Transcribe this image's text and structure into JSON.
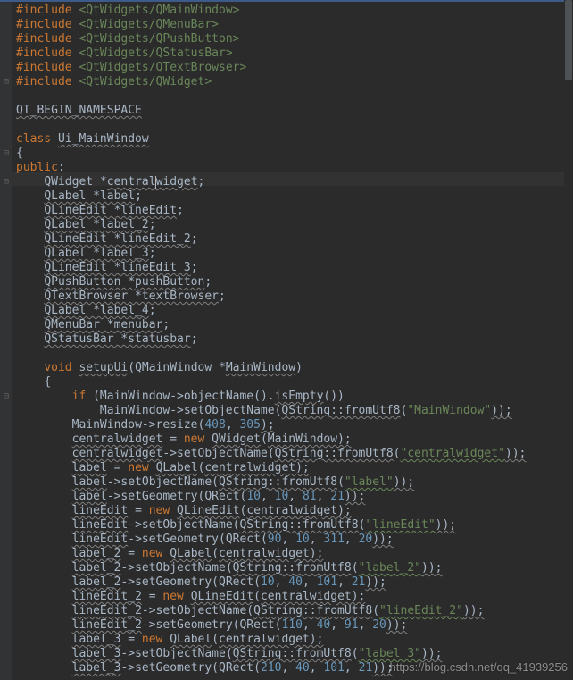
{
  "watermark": "https://blog.csdn.net/qq_41939256",
  "gutter_foldmarks": {
    "0": "",
    "1": "",
    "2": "",
    "3": "",
    "4": "",
    "5": "⊟",
    "9": "",
    "10": "⊟",
    "12": "⊟",
    "26": "",
    "27": "⊟"
  },
  "code_lines": [
    {
      "indent": 0,
      "segs": [
        {
          "cls": "tok-pre",
          "t": "#include "
        },
        {
          "cls": "tok-inc",
          "t": "<QtWidgets/QMainWindow>"
        }
      ]
    },
    {
      "indent": 0,
      "segs": [
        {
          "cls": "tok-pre",
          "t": "#include "
        },
        {
          "cls": "tok-inc",
          "t": "<QtWidgets/QMenuBar>"
        }
      ]
    },
    {
      "indent": 0,
      "segs": [
        {
          "cls": "tok-pre",
          "t": "#include "
        },
        {
          "cls": "tok-inc",
          "t": "<QtWidgets/QPushButton>"
        }
      ]
    },
    {
      "indent": 0,
      "segs": [
        {
          "cls": "tok-pre",
          "t": "#include "
        },
        {
          "cls": "tok-inc",
          "t": "<QtWidgets/QStatusBar>"
        }
      ]
    },
    {
      "indent": 0,
      "segs": [
        {
          "cls": "tok-pre",
          "t": "#include "
        },
        {
          "cls": "tok-inc",
          "t": "<QtWidgets/QTextBrowser>"
        }
      ]
    },
    {
      "indent": 0,
      "segs": [
        {
          "cls": "tok-pre",
          "t": "#include "
        },
        {
          "cls": "tok-inc",
          "t": "<QtWidgets/QWidget>"
        }
      ]
    },
    {
      "indent": 0,
      "segs": []
    },
    {
      "indent": 0,
      "segs": [
        {
          "cls": "tok-macro us",
          "t": "QT_BEGIN_NAMESPACE"
        }
      ]
    },
    {
      "indent": 0,
      "segs": []
    },
    {
      "indent": 0,
      "segs": [
        {
          "cls": "tok-kw",
          "t": "class "
        },
        {
          "cls": "us",
          "t": "Ui_MainWindow"
        }
      ]
    },
    {
      "indent": 0,
      "segs": [
        {
          "cls": "tok-punc",
          "t": "{"
        }
      ]
    },
    {
      "indent": 0,
      "segs": [
        {
          "cls": "tok-kw",
          "t": "public"
        },
        {
          "cls": "tok-punc",
          "t": ":"
        }
      ]
    },
    {
      "indent": 4,
      "hl": true,
      "segs": [
        {
          "cls": "",
          "t": "QWidget *"
        },
        {
          "cls": "us",
          "t": "central"
        },
        {
          "cls": "",
          "caret": true,
          "t": ""
        },
        {
          "cls": "us",
          "t": "widget"
        },
        {
          "cls": "tok-punc",
          "t": ";"
        }
      ]
    },
    {
      "indent": 4,
      "segs": [
        {
          "cls": "us",
          "t": "QLabel *label"
        },
        {
          "cls": "tok-punc",
          "t": ";"
        }
      ]
    },
    {
      "indent": 4,
      "segs": [
        {
          "cls": "us",
          "t": "QLineEdit *lineEdit"
        },
        {
          "cls": "tok-punc",
          "t": ";"
        }
      ]
    },
    {
      "indent": 4,
      "segs": [
        {
          "cls": "us",
          "t": "QLabel *label_2"
        },
        {
          "cls": "tok-punc",
          "t": ";"
        }
      ]
    },
    {
      "indent": 4,
      "segs": [
        {
          "cls": "us",
          "t": "QLineEdit *lineEdit_2"
        },
        {
          "cls": "tok-punc",
          "t": ";"
        }
      ]
    },
    {
      "indent": 4,
      "segs": [
        {
          "cls": "us",
          "t": "QLabel *label_3"
        },
        {
          "cls": "tok-punc",
          "t": ";"
        }
      ]
    },
    {
      "indent": 4,
      "segs": [
        {
          "cls": "us",
          "t": "QLineEdit *lineEdit_3"
        },
        {
          "cls": "tok-punc",
          "t": ";"
        }
      ]
    },
    {
      "indent": 4,
      "segs": [
        {
          "cls": "us",
          "t": "QPushButton *pushButton"
        },
        {
          "cls": "tok-punc",
          "t": ";"
        }
      ]
    },
    {
      "indent": 4,
      "segs": [
        {
          "cls": "us",
          "t": "QTextBrowser *textBrowser"
        },
        {
          "cls": "tok-punc",
          "t": ";"
        }
      ]
    },
    {
      "indent": 4,
      "segs": [
        {
          "cls": "us",
          "t": "QLabel *label_4"
        },
        {
          "cls": "tok-punc",
          "t": ";"
        }
      ]
    },
    {
      "indent": 4,
      "segs": [
        {
          "cls": "us",
          "t": "QMenuBar *menubar"
        },
        {
          "cls": "tok-punc",
          "t": ";"
        }
      ]
    },
    {
      "indent": 4,
      "segs": [
        {
          "cls": "us",
          "t": "QStatusBar *statusbar"
        },
        {
          "cls": "tok-punc",
          "t": ";"
        }
      ]
    },
    {
      "indent": 0,
      "segs": []
    },
    {
      "indent": 4,
      "segs": [
        {
          "cls": "tok-kw",
          "t": "void "
        },
        {
          "cls": "us",
          "t": "setupUi"
        },
        {
          "cls": "",
          "t": "(QMainWindow *"
        },
        {
          "cls": "us",
          "t": "MainWindow"
        },
        {
          "cls": "",
          "t": ")"
        }
      ]
    },
    {
      "indent": 4,
      "segs": [
        {
          "cls": "tok-punc",
          "t": "{"
        }
      ]
    },
    {
      "indent": 8,
      "segs": [
        {
          "cls": "tok-kw",
          "t": "if "
        },
        {
          "cls": "",
          "t": "(MainWindow->objectName()."
        },
        {
          "cls": "us",
          "t": "isEmpty"
        },
        {
          "cls": "",
          "t": "())"
        }
      ]
    },
    {
      "indent": 12,
      "segs": [
        {
          "cls": "",
          "t": "MainWindow->setObjectName("
        },
        {
          "cls": "us",
          "t": "QString::fromUtf8"
        },
        {
          "cls": "",
          "t": "("
        },
        {
          "cls": "tok-str",
          "t": "\"MainWindow\""
        },
        {
          "cls": "us",
          "t": "));"
        }
      ]
    },
    {
      "indent": 8,
      "segs": [
        {
          "cls": "",
          "t": "MainWindow->resize("
        },
        {
          "cls": "tok-num",
          "t": "408"
        },
        {
          "cls": "",
          "t": ", "
        },
        {
          "cls": "tok-num",
          "t": "305"
        },
        {
          "cls": "us",
          "t": ");"
        }
      ]
    },
    {
      "indent": 8,
      "segs": [
        {
          "cls": "us",
          "t": "centralwidget"
        },
        {
          "cls": "",
          "t": " = "
        },
        {
          "cls": "tok-kw",
          "t": "new "
        },
        {
          "cls": "us",
          "t": "QWidget"
        },
        {
          "cls": "",
          "t": "("
        },
        {
          "cls": "us",
          "t": "MainWindow);"
        }
      ]
    },
    {
      "indent": 8,
      "segs": [
        {
          "cls": "us",
          "t": "centralwidget"
        },
        {
          "cls": "",
          "t": "->setObjectName("
        },
        {
          "cls": "us",
          "t": "QString::fromUtf8"
        },
        {
          "cls": "",
          "t": "("
        },
        {
          "cls": "tok-str usg",
          "t": "\"centralwidget\""
        },
        {
          "cls": "us",
          "t": "));"
        }
      ]
    },
    {
      "indent": 8,
      "segs": [
        {
          "cls": "us",
          "t": "label"
        },
        {
          "cls": "",
          "t": " = "
        },
        {
          "cls": "tok-kw",
          "t": "new "
        },
        {
          "cls": "us",
          "t": "QLabel"
        },
        {
          "cls": "",
          "t": "("
        },
        {
          "cls": "us",
          "t": "centralwidget);"
        }
      ]
    },
    {
      "indent": 8,
      "segs": [
        {
          "cls": "us",
          "t": "label"
        },
        {
          "cls": "",
          "t": "->setObjectName("
        },
        {
          "cls": "us",
          "t": "QString::fromUtf8"
        },
        {
          "cls": "",
          "t": "("
        },
        {
          "cls": "tok-str usg",
          "t": "\"label\""
        },
        {
          "cls": "us",
          "t": "));"
        }
      ]
    },
    {
      "indent": 8,
      "segs": [
        {
          "cls": "us",
          "t": "label"
        },
        {
          "cls": "",
          "t": "->setGeometry(QRect("
        },
        {
          "cls": "tok-num",
          "t": "10"
        },
        {
          "cls": "",
          "t": ", "
        },
        {
          "cls": "tok-num",
          "t": "10"
        },
        {
          "cls": "",
          "t": ", "
        },
        {
          "cls": "tok-num",
          "t": "81"
        },
        {
          "cls": "",
          "t": ", "
        },
        {
          "cls": "tok-num",
          "t": "21"
        },
        {
          "cls": "us",
          "t": "));"
        }
      ]
    },
    {
      "indent": 8,
      "segs": [
        {
          "cls": "us",
          "t": "lineEdit"
        },
        {
          "cls": "",
          "t": " = "
        },
        {
          "cls": "tok-kw",
          "t": "new "
        },
        {
          "cls": "us",
          "t": "QLineEdit"
        },
        {
          "cls": "",
          "t": "("
        },
        {
          "cls": "us",
          "t": "centralwidget);"
        }
      ]
    },
    {
      "indent": 8,
      "segs": [
        {
          "cls": "us",
          "t": "lineEdit"
        },
        {
          "cls": "",
          "t": "->setObjectName("
        },
        {
          "cls": "us",
          "t": "QString::fromUtf8"
        },
        {
          "cls": "",
          "t": "("
        },
        {
          "cls": "tok-str usg",
          "t": "\"lineEdit\""
        },
        {
          "cls": "us",
          "t": "));"
        }
      ]
    },
    {
      "indent": 8,
      "segs": [
        {
          "cls": "us",
          "t": "lineEdit"
        },
        {
          "cls": "",
          "t": "->setGeometry(QRect("
        },
        {
          "cls": "tok-num",
          "t": "90"
        },
        {
          "cls": "",
          "t": ", "
        },
        {
          "cls": "tok-num",
          "t": "10"
        },
        {
          "cls": "",
          "t": ", "
        },
        {
          "cls": "tok-num",
          "t": "311"
        },
        {
          "cls": "",
          "t": ", "
        },
        {
          "cls": "tok-num",
          "t": "20"
        },
        {
          "cls": "us",
          "t": "));"
        }
      ]
    },
    {
      "indent": 8,
      "segs": [
        {
          "cls": "us",
          "t": "label_2"
        },
        {
          "cls": "",
          "t": " = "
        },
        {
          "cls": "tok-kw",
          "t": "new "
        },
        {
          "cls": "us",
          "t": "QLabel"
        },
        {
          "cls": "",
          "t": "("
        },
        {
          "cls": "us",
          "t": "centralwidget);"
        }
      ]
    },
    {
      "indent": 8,
      "segs": [
        {
          "cls": "us",
          "t": "label_2"
        },
        {
          "cls": "",
          "t": "->setObjectName("
        },
        {
          "cls": "us",
          "t": "QString::fromUtf8"
        },
        {
          "cls": "",
          "t": "("
        },
        {
          "cls": "tok-str usg",
          "t": "\"label_2\""
        },
        {
          "cls": "us",
          "t": "));"
        }
      ]
    },
    {
      "indent": 8,
      "segs": [
        {
          "cls": "us",
          "t": "label_2"
        },
        {
          "cls": "",
          "t": "->setGeometry(QRect("
        },
        {
          "cls": "tok-num",
          "t": "10"
        },
        {
          "cls": "",
          "t": ", "
        },
        {
          "cls": "tok-num",
          "t": "40"
        },
        {
          "cls": "",
          "t": ", "
        },
        {
          "cls": "tok-num",
          "t": "101"
        },
        {
          "cls": "",
          "t": ", "
        },
        {
          "cls": "tok-num",
          "t": "21"
        },
        {
          "cls": "us",
          "t": "));"
        }
      ]
    },
    {
      "indent": 8,
      "segs": [
        {
          "cls": "us",
          "t": "lineEdit_2"
        },
        {
          "cls": "",
          "t": " = "
        },
        {
          "cls": "tok-kw",
          "t": "new "
        },
        {
          "cls": "us",
          "t": "QLineEdit"
        },
        {
          "cls": "",
          "t": "("
        },
        {
          "cls": "us",
          "t": "centralwidget);"
        }
      ]
    },
    {
      "indent": 8,
      "segs": [
        {
          "cls": "us",
          "t": "lineEdit_2"
        },
        {
          "cls": "",
          "t": "->setObjectName("
        },
        {
          "cls": "us",
          "t": "QString::fromUtf8"
        },
        {
          "cls": "",
          "t": "("
        },
        {
          "cls": "tok-str usg",
          "t": "\"lineEdit_2\""
        },
        {
          "cls": "us",
          "t": "));"
        }
      ]
    },
    {
      "indent": 8,
      "segs": [
        {
          "cls": "us",
          "t": "lineEdit_2"
        },
        {
          "cls": "",
          "t": "->setGeometry(QRect("
        },
        {
          "cls": "tok-num",
          "t": "110"
        },
        {
          "cls": "",
          "t": ", "
        },
        {
          "cls": "tok-num",
          "t": "40"
        },
        {
          "cls": "",
          "t": ", "
        },
        {
          "cls": "tok-num",
          "t": "91"
        },
        {
          "cls": "",
          "t": ", "
        },
        {
          "cls": "tok-num",
          "t": "20"
        },
        {
          "cls": "us",
          "t": "));"
        }
      ]
    },
    {
      "indent": 8,
      "segs": [
        {
          "cls": "us",
          "t": "label_3"
        },
        {
          "cls": "",
          "t": " = "
        },
        {
          "cls": "tok-kw",
          "t": "new "
        },
        {
          "cls": "us",
          "t": "QLabel"
        },
        {
          "cls": "",
          "t": "("
        },
        {
          "cls": "us",
          "t": "centralwidget);"
        }
      ]
    },
    {
      "indent": 8,
      "segs": [
        {
          "cls": "us",
          "t": "label_3"
        },
        {
          "cls": "",
          "t": "->setObjectName("
        },
        {
          "cls": "us",
          "t": "QString::fromUtf8"
        },
        {
          "cls": "",
          "t": "("
        },
        {
          "cls": "tok-str usg",
          "t": "\"label_3\""
        },
        {
          "cls": "us",
          "t": "));"
        }
      ]
    },
    {
      "indent": 8,
      "segs": [
        {
          "cls": "us",
          "t": "label_3"
        },
        {
          "cls": "",
          "t": "->setGeometry(QRect("
        },
        {
          "cls": "tok-num",
          "t": "210"
        },
        {
          "cls": "",
          "t": ", "
        },
        {
          "cls": "tok-num",
          "t": "40"
        },
        {
          "cls": "",
          "t": ", "
        },
        {
          "cls": "tok-num",
          "t": "101"
        },
        {
          "cls": "",
          "t": ", "
        },
        {
          "cls": "tok-num",
          "t": "21"
        },
        {
          "cls": "us",
          "t": "));"
        }
      ]
    }
  ]
}
